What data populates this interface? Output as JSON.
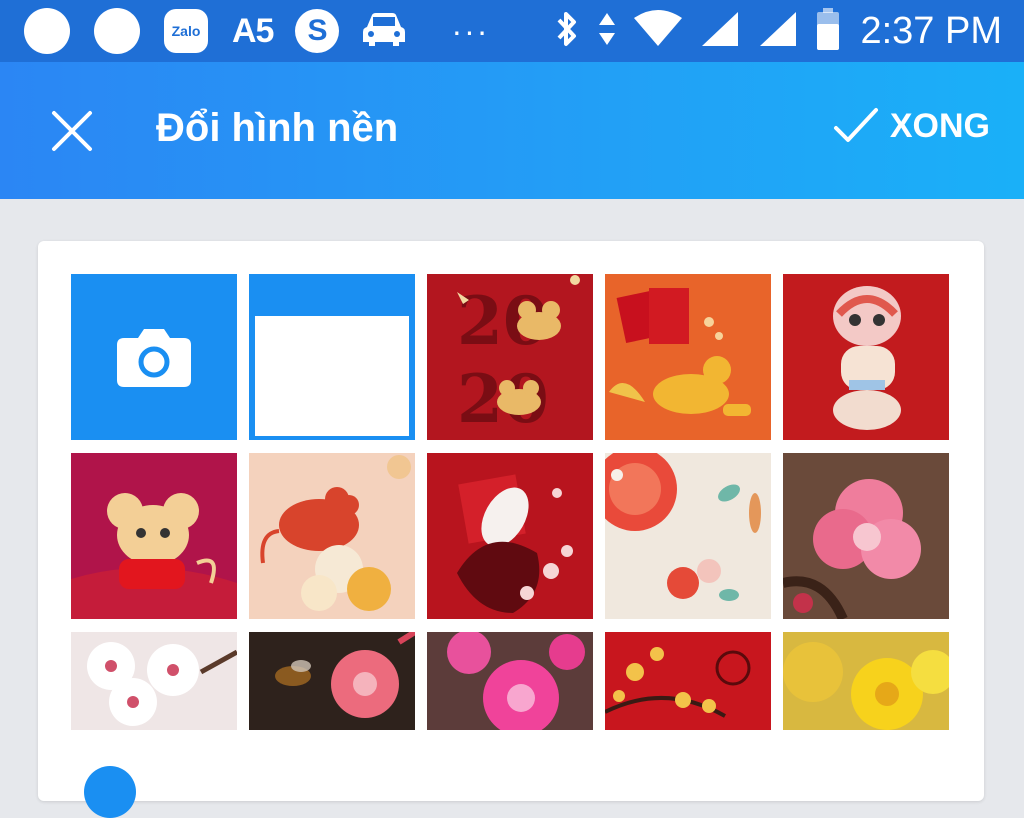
{
  "status_bar": {
    "notification_icons": [
      "circle-icon",
      "circle-icon",
      "zalo-icon",
      "a5-icon",
      "s-app-icon",
      "car-icon",
      "more-dots-icon"
    ],
    "zalo_label": "Zalo",
    "a5_label": "A5",
    "s_label": "S",
    "more_label": "···",
    "system_icons": [
      "bluetooth-icon",
      "data-arrows-icon",
      "wifi-icon",
      "signal-icon",
      "signal-icon",
      "battery-icon"
    ],
    "time": "2:37 PM"
  },
  "app_bar": {
    "title": "Đổi hình nền",
    "done_label": "XONG",
    "background_gradient": [
      "#2b86f4",
      "#1ab0f8"
    ]
  },
  "wallpaper_grid": {
    "accent": "#1a8ff2",
    "tiles": [
      {
        "name": "camera",
        "icon": "camera-icon"
      },
      {
        "name": "plain-white"
      },
      {
        "name": "2020-mice-red"
      },
      {
        "name": "golden-rat-lucky-envelope-orange"
      },
      {
        "name": "lion-dance-rat-red"
      },
      {
        "name": "cute-mouse-magenta"
      },
      {
        "name": "red-rat-peonies-cream"
      },
      {
        "name": "white-rat-red-floral"
      },
      {
        "name": "paper-flowers-cream"
      },
      {
        "name": "pink-peach-blossom-brown"
      },
      {
        "name": "white-cherry-blossoms"
      },
      {
        "name": "bee-pink-blossom-dark"
      },
      {
        "name": "pink-peach-flowers"
      },
      {
        "name": "apricot-blossoms-red"
      },
      {
        "name": "yellow-apricot-flowers"
      }
    ]
  }
}
